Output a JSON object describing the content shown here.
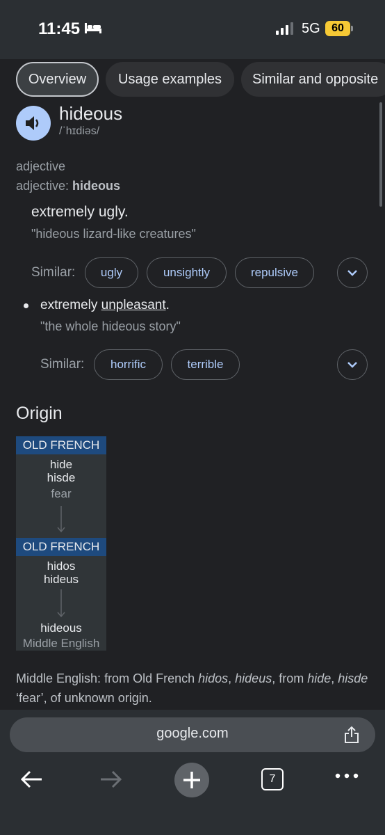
{
  "status": {
    "time": "11:45",
    "network": "5G",
    "battery": "60"
  },
  "tabs": [
    {
      "label": "Overview"
    },
    {
      "label": "Usage examples"
    },
    {
      "label": "Similar and opposite"
    }
  ],
  "entry": {
    "word": "hideous",
    "phonetic": "/ˈhɪdiəs/",
    "part_of_speech": "adjective",
    "pos_prefix": "adjective: ",
    "pos_word": "hideous",
    "senses": [
      {
        "definition": "extremely ugly.",
        "example": "\"hideous lizard-like creatures\"",
        "similar_label": "Similar:",
        "similar": [
          "ugly",
          "unsightly",
          "repulsive"
        ]
      },
      {
        "definition_prefix": "extremely ",
        "definition_link": "unpleasant",
        "definition_suffix": ".",
        "example": "\"the whole hideous story\"",
        "similar_label": "Similar:",
        "similar": [
          "horrific",
          "terrible"
        ]
      }
    ]
  },
  "origin": {
    "title": "Origin",
    "stage1": {
      "language": "OLD FRENCH",
      "words": [
        "hide",
        "hisde"
      ],
      "gloss": "fear"
    },
    "stage2": {
      "language": "OLD FRENCH",
      "words": [
        "hidos",
        "hideus"
      ]
    },
    "stage3": {
      "word": "hideous",
      "language": "Middle English"
    },
    "text": {
      "p1": "Middle English: from Old French ",
      "i1": "hidos",
      "p2": ", ",
      "i2": "hideus",
      "p3": ", from ",
      "i3": "hide",
      "p4": ", ",
      "i4": "hisde",
      "p5": " ‘fear’, of unknown origin."
    }
  },
  "browser": {
    "url": "google.com",
    "tab_count": "7"
  }
}
